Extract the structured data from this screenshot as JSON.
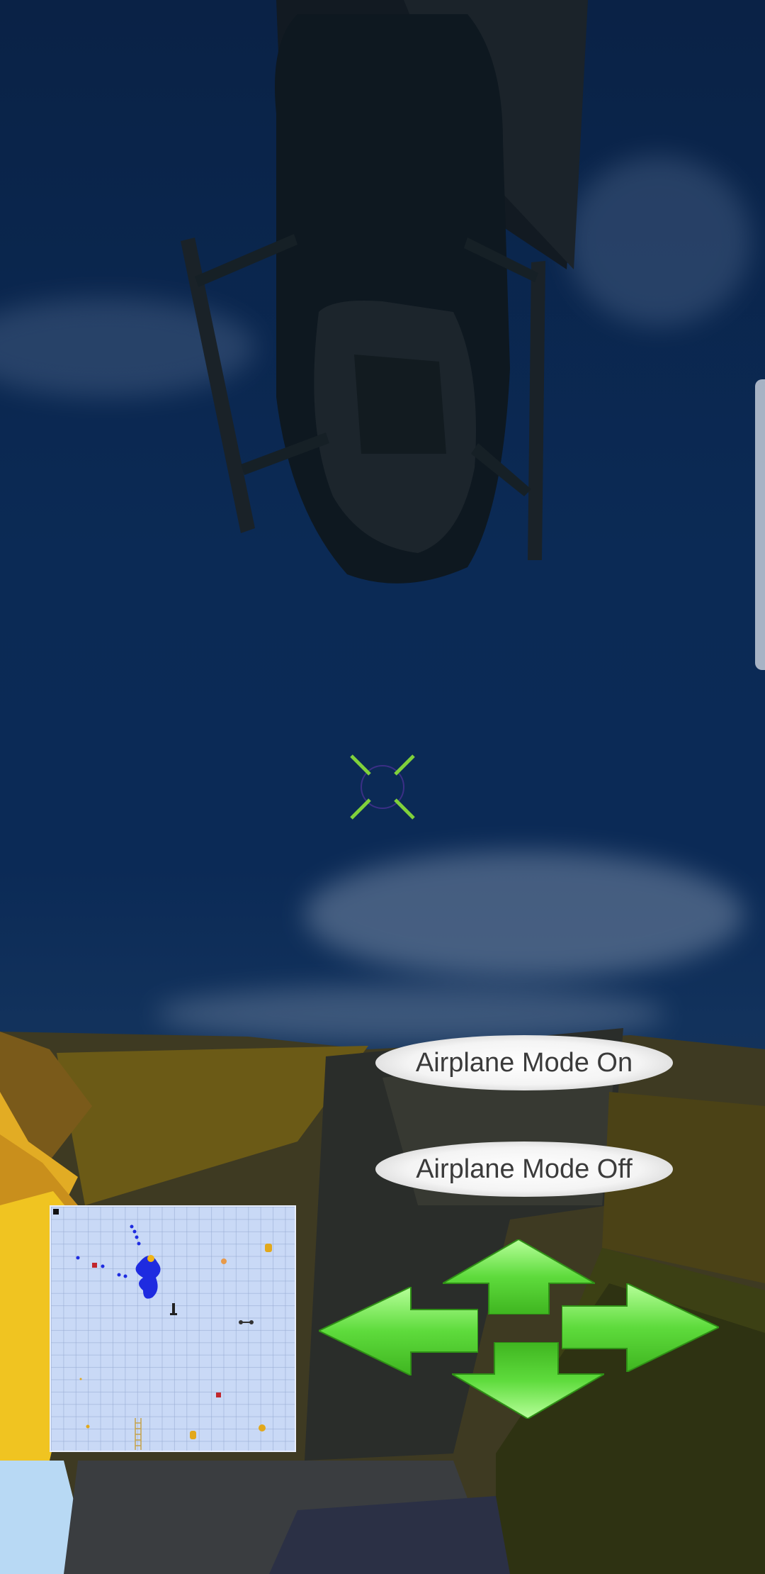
{
  "hud": {
    "airplane_mode_on": "Airplane Mode On",
    "airplane_mode_off": "Airplane Mode Off"
  },
  "icons": {
    "crosshair": "crosshair-icon",
    "arrow_up": "arrow-up-icon",
    "arrow_down": "arrow-down-icon",
    "arrow_left": "arrow-left-icon",
    "arrow_right": "arrow-right-icon"
  },
  "colors": {
    "arrow_green": "#5edb3c",
    "crosshair_green": "#7fd13b",
    "minimap_bg": "#c9d9f6",
    "player_blue": "#1e2be0"
  }
}
